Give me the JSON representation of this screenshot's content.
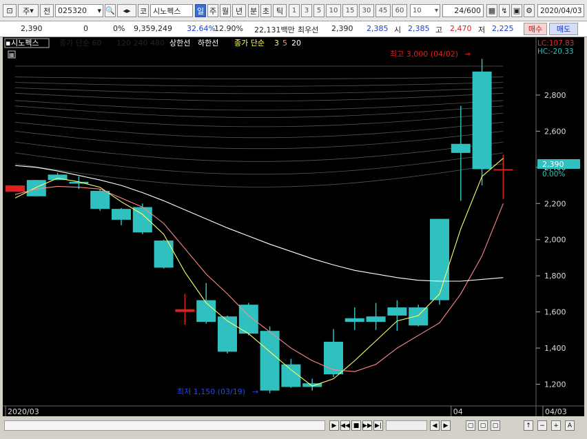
{
  "toolbar": {
    "market_label": "주",
    "all_label": "전",
    "code": "025320",
    "stock_label": "코",
    "stock_name": "시노펙스",
    "periods": [
      "일",
      "주",
      "월",
      "년",
      "분",
      "초",
      "틱"
    ],
    "selected_period": "일",
    "intervals": [
      "1",
      "3",
      "5",
      "10",
      "15",
      "30",
      "45",
      "60"
    ],
    "interval_select": "10",
    "count": "24",
    "count_total": "/600",
    "date": "2020/04/03"
  },
  "quote": {
    "price": "2,390",
    "change": "0",
    "change_pct": "0%",
    "volume": "9,359,249",
    "ratio1": "32.64%",
    "ratio2": "12.90%",
    "amount": "22,131백만",
    "best_label": "최우선",
    "best_sell": "2,390",
    "best_buy": "2,385",
    "open_label": "시",
    "open": "2,385",
    "high_label": "고",
    "high": "2,470",
    "low_label": "저",
    "low": "2,225",
    "buy_button": "매수",
    "sell_button": "매도"
  },
  "legend": {
    "name": "시노펙스",
    "ma_hidden": "종가 단순 60",
    "ma_hidden2": "120  240  480",
    "upper": "상한선",
    "lower": "하한선",
    "ma_label": "종가 단순",
    "ma3": "3",
    "ma5": "5",
    "ma20": "20"
  },
  "right_info": {
    "lc": "LC:107.83",
    "hc": "HC:-20.33"
  },
  "annotations": {
    "high": "최고 3,000 (04/02)",
    "low": "최저 1,150 (03/19)"
  },
  "price_badge": {
    "value": "2,390",
    "pct": "0.00%"
  },
  "colors": {
    "up": "#e0201a",
    "down": "#30c0c0",
    "ma3": "#ffff66",
    "ma5": "#ff8888",
    "band": "#ffffff"
  },
  "chart_data": {
    "type": "candlestick",
    "ylim": [
      1080,
      3120
    ],
    "yticks": [
      1200,
      1400,
      1600,
      1800,
      2000,
      2200,
      2400,
      2600,
      2800
    ],
    "ytick_labels": [
      "1,200",
      "1,400",
      "1,600",
      "1,800",
      "2,000",
      "2,200",
      "2,400",
      "2,600",
      "2,800"
    ],
    "xlabels": [
      {
        "label": "2020/03",
        "index": 0
      },
      {
        "label": "04",
        "index": 21
      },
      {
        "label": "04/03",
        "index": 25
      }
    ],
    "candles": [
      {
        "o": 2265,
        "c": 2300,
        "h": 2300,
        "l": 2265
      },
      {
        "o": 2330,
        "c": 2240,
        "h": 2330,
        "l": 2240
      },
      {
        "o": 2360,
        "c": 2330,
        "h": 2370,
        "l": 2330
      },
      {
        "o": 2320,
        "c": 2310,
        "h": 2350,
        "l": 2280
      },
      {
        "o": 2270,
        "c": 2170,
        "h": 2280,
        "l": 2160
      },
      {
        "o": 2170,
        "c": 2110,
        "h": 2175,
        "l": 2080
      },
      {
        "o": 2180,
        "c": 2040,
        "h": 2200,
        "l": 2030
      },
      {
        "o": 1995,
        "c": 1845,
        "h": 2000,
        "l": 1840
      },
      {
        "o": 1600,
        "c": 1615,
        "h": 1700,
        "l": 1530
      },
      {
        "o": 1665,
        "c": 1545,
        "h": 1760,
        "l": 1535
      },
      {
        "o": 1575,
        "c": 1380,
        "h": 1580,
        "l": 1370
      },
      {
        "o": 1640,
        "c": 1480,
        "h": 1650,
        "l": 1470
      },
      {
        "o": 1495,
        "c": 1165,
        "h": 1520,
        "l": 1150
      },
      {
        "o": 1310,
        "c": 1185,
        "h": 1340,
        "l": 1180
      },
      {
        "o": 1205,
        "c": 1185,
        "h": 1230,
        "l": 1165
      },
      {
        "o": 1435,
        "c": 1255,
        "h": 1505,
        "l": 1240
      },
      {
        "o": 1565,
        "c": 1545,
        "h": 1625,
        "l": 1500
      },
      {
        "o": 1575,
        "c": 1545,
        "h": 1650,
        "l": 1500
      },
      {
        "o": 1625,
        "c": 1580,
        "h": 1665,
        "l": 1495
      },
      {
        "o": 1625,
        "c": 1525,
        "h": 1640,
        "l": 1520
      },
      {
        "o": 2115,
        "c": 1665,
        "h": 2115,
        "l": 1640
      },
      {
        "o": 2530,
        "c": 2480,
        "h": 2740,
        "l": 2215
      },
      {
        "o": 2930,
        "c": 2390,
        "h": 3000,
        "l": 2300
      },
      {
        "o": 2390,
        "c": 2390,
        "h": 2470,
        "l": 2225
      }
    ],
    "series": [
      {
        "name": "3",
        "values": [
          2230,
          2290,
          2340,
          2320,
          2290,
          2210,
          2140,
          2030,
          1820,
          1650,
          1550,
          1480,
          1380,
          1280,
          1190,
          1230,
          1330,
          1440,
          1550,
          1580,
          1700,
          2060,
          2350,
          2450
        ]
      },
      {
        "name": "5",
        "values": [
          2250,
          2280,
          2295,
          2290,
          2280,
          2230,
          2180,
          2090,
          1950,
          1810,
          1700,
          1580,
          1490,
          1400,
          1330,
          1280,
          1270,
          1310,
          1400,
          1470,
          1540,
          1700,
          1910,
          2200
        ]
      },
      {
        "name": "20",
        "values": [
          2410,
          2400,
          2380,
          2355,
          2330,
          2300,
          2260,
          2215,
          2165,
          2115,
          2065,
          2020,
          1975,
          1935,
          1895,
          1860,
          1830,
          1810,
          1790,
          1775,
          1770,
          1770,
          1780,
          1790
        ]
      }
    ]
  }
}
